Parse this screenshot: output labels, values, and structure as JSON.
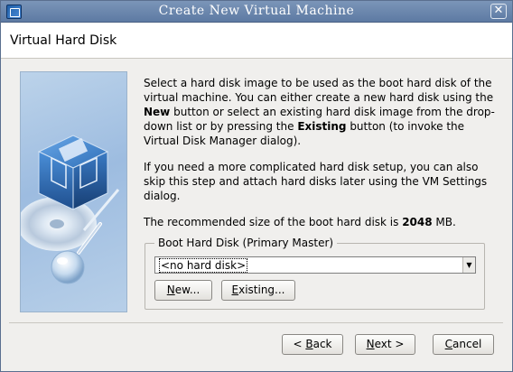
{
  "window": {
    "title": "Create New Virtual Machine",
    "close_glyph": "✕"
  },
  "header": {
    "title": "Virtual Hard Disk"
  },
  "description": {
    "p1_a": "Select a hard disk image to be used as the boot hard disk of the virtual machine. You can either create a new hard disk using the ",
    "p1_new": "New",
    "p1_b": " button or select an existing hard disk image from the drop-down list or by pressing the ",
    "p1_existing": "Existing",
    "p1_c": " button (to invoke the Virtual Disk Manager dialog).",
    "p2": "If you need a more complicated hard disk setup, you can also skip this step and attach hard disks later using the VM Settings dialog.",
    "p3_a": "The recommended size of the boot hard disk is ",
    "p3_size": "2048",
    "p3_b": " MB."
  },
  "boot_disk": {
    "group_label": "Boot Hard Disk (Primary Master)",
    "selected": "<no hard disk>",
    "new_button": {
      "pre": "",
      "mnemonic": "N",
      "post": "ew..."
    },
    "existing_button": {
      "pre": "",
      "mnemonic": "E",
      "post": "xisting..."
    }
  },
  "footer": {
    "back": {
      "pre": "< ",
      "mnemonic": "B",
      "post": "ack"
    },
    "next": {
      "pre": "",
      "mnemonic": "N",
      "post": "ext >"
    },
    "cancel": {
      "pre": "",
      "mnemonic": "C",
      "post": "ancel"
    }
  },
  "icons": {
    "app": "virtualbox-icon",
    "close": "close-icon",
    "dropdown": "chevron-down-icon",
    "illustration": "virtualbox-cube-disc-illustration"
  }
}
